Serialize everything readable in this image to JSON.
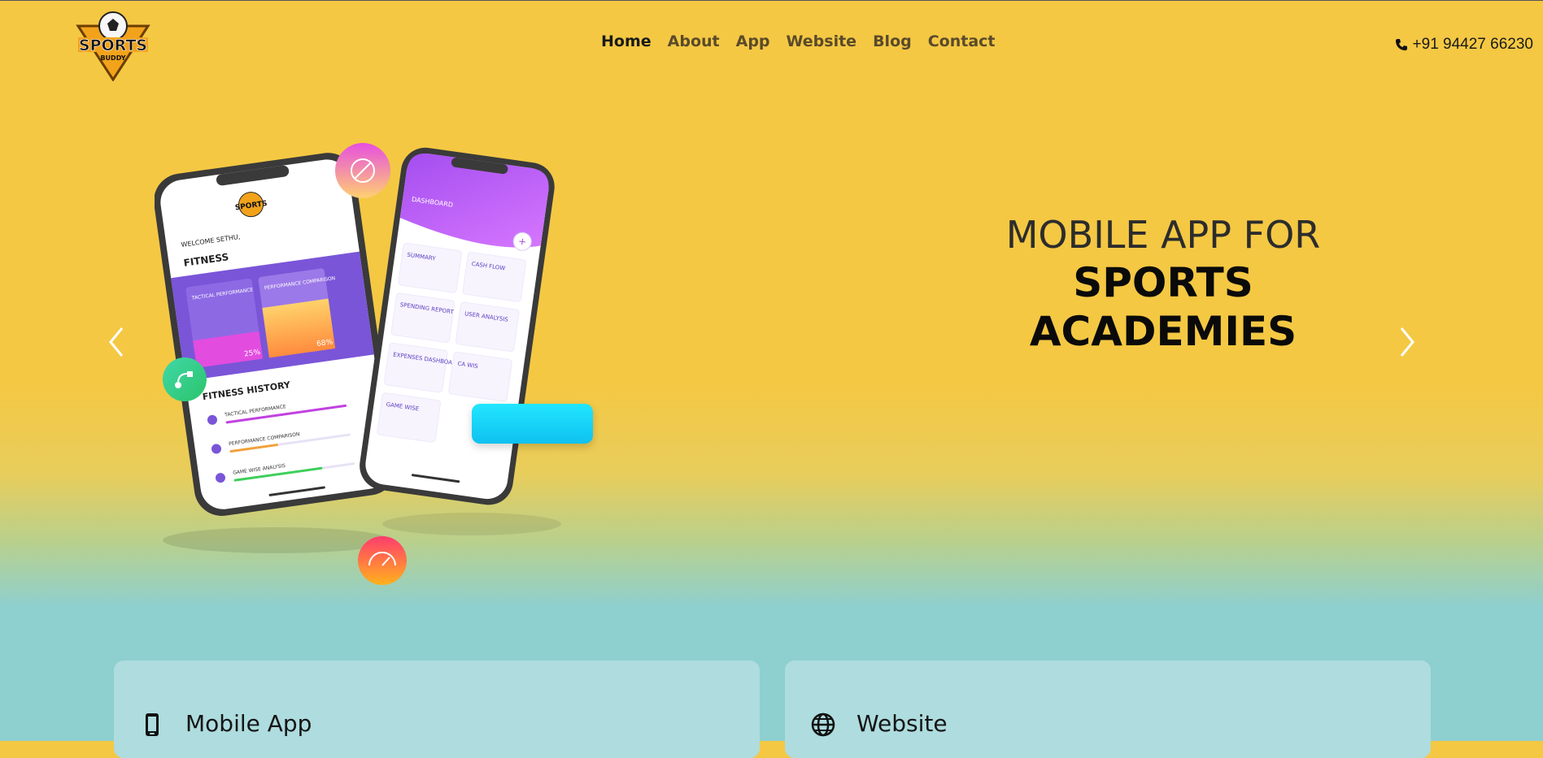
{
  "brand": {
    "logo_line1": "SPORTS",
    "logo_line2": "BUDDY"
  },
  "nav": {
    "items": [
      {
        "label": "Home",
        "active": true
      },
      {
        "label": "About"
      },
      {
        "label": "App"
      },
      {
        "label": "Website"
      },
      {
        "label": "Blog"
      },
      {
        "label": "Contact"
      }
    ]
  },
  "header": {
    "phone": "+91 94427 66230"
  },
  "hero": {
    "line1": "MOBILE APP FOR",
    "line2": "SPORTS ACADEMIES",
    "phone_left": {
      "welcome": "WELCOME SETHU,",
      "section": "FITNESS",
      "tile1": "TACTICAL PERFORMANCE",
      "tile1_pct": "25%",
      "tile2": "PERFORMANCE COMPARISON",
      "tile2_pct": "68%",
      "history_title": "FITNESS HISTORY",
      "history_items": [
        "TACTICAL PERFORMANCE",
        "PERFORMANCE COMPARISON",
        "GAME WISE ANALYSIS"
      ]
    },
    "phone_right": {
      "title": "DASHBOARD",
      "tiles": [
        "SUMMARY",
        "CASH FLOW",
        "SPENDING REPORT",
        "USER ANALYSIS",
        "EXPENSES DASHBOARD",
        "CA WIS",
        "GAME WISE"
      ]
    }
  },
  "cards": [
    {
      "title": "Mobile App",
      "icon": "mobile-icon"
    },
    {
      "title": "Website",
      "icon": "globe-icon"
    }
  ],
  "colors": {
    "accent_yellow": "#f4c843",
    "teal": "#8ecfcf",
    "card_bg": "#aedcdf",
    "purple": "#a54ddb"
  }
}
